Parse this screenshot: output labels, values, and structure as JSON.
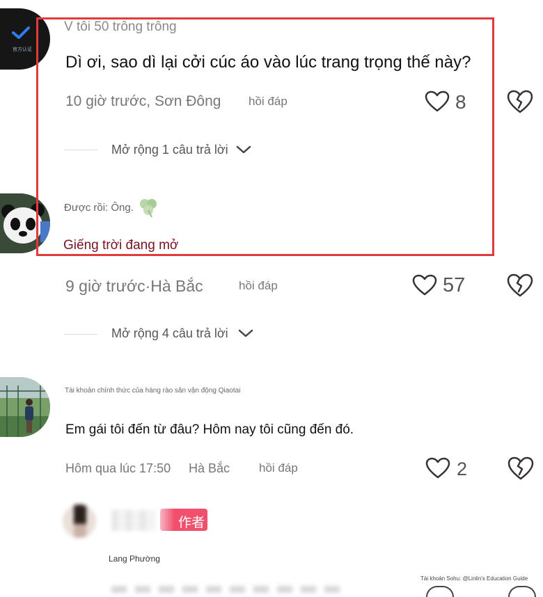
{
  "comments": [
    {
      "username": "V tôi 50 trông trông",
      "avatar_badge": "官方认证",
      "text": "Dì ơi, sao dì lại cởi cúc áo vào lúc trang trọng thế này?",
      "time_location": "10 giờ trước, Sơn Đông",
      "reply_label": "hồi đáp",
      "likes": "8",
      "expand_label": "Mở rộng 1 câu trả lời"
    },
    {
      "username": "Được rồi: Ông.",
      "text": "Giếng trời đang mở",
      "time_location": "9 giờ trước·Hà Bắc",
      "reply_label": "hồi đáp",
      "likes": "57",
      "expand_label": "Mở rộng 4 câu trả lời"
    },
    {
      "username": "Tài khoản chính thức của hàng rào sân vận động Qiaotai",
      "text": "Em gái tôi đến từ đâu? Hôm nay tôi cũng đến đó.",
      "time": "Hôm qua lúc 17:50",
      "location": "Hà Bắc",
      "reply_label": "hồi đáp",
      "likes": "2"
    },
    {
      "author_badge": "作者",
      "caption": "Lang Phường"
    }
  ],
  "watermark": "Tài khoản Sohu: @Linlin's Education Guide",
  "colors": {
    "highlight_border": "#e0393e",
    "link_text": "#7a1020",
    "author_badge": "#f0506e"
  }
}
